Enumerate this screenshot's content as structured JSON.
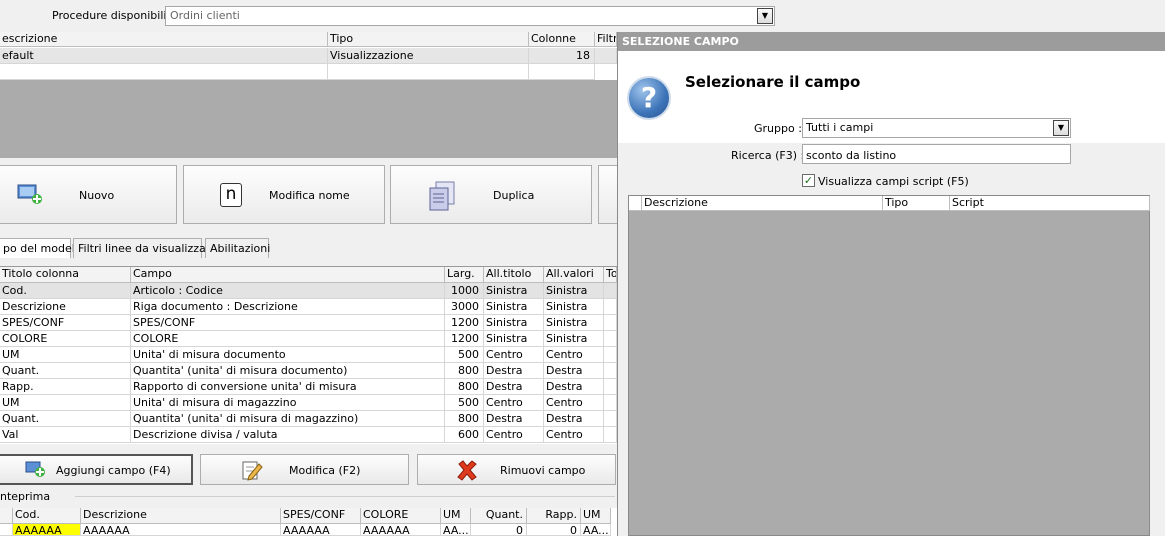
{
  "procedure": {
    "label": "Procedure disponibili :",
    "value": "Ordini clienti"
  },
  "model_grid": {
    "headers": [
      "escrizione",
      "Tipo",
      "Colonne",
      "Filtri"
    ],
    "rows": [
      {
        "descrizione": "efault",
        "tipo": "Visualizzazione",
        "colonne": "18"
      }
    ]
  },
  "buttons": {
    "nuovo": "Nuovo",
    "modifica_nome": "Modifica nome",
    "duplica": "Duplica",
    "n_glyph": "n"
  },
  "tabs": [
    "po del modello",
    "Filtri linee da visualizzare",
    "Abilitazioni"
  ],
  "columns_grid": {
    "headers": [
      "Titolo colonna",
      "Campo",
      "Larg.",
      "All.titolo",
      "All.valori",
      "To"
    ],
    "rows": [
      [
        "Cod.",
        "Articolo : Codice",
        "1000",
        "Sinistra",
        "Sinistra"
      ],
      [
        "Descrizione",
        "Riga documento : Descrizione",
        "3000",
        "Sinistra",
        "Sinistra"
      ],
      [
        "SPES/CONF",
        "SPES/CONF",
        "1200",
        "Sinistra",
        "Sinistra"
      ],
      [
        "COLORE",
        "COLORE",
        "1200",
        "Sinistra",
        "Sinistra"
      ],
      [
        "UM",
        "Unita' di misura documento",
        "500",
        "Centro",
        "Centro"
      ],
      [
        "Quant.",
        "Quantita' (unita' di misura documento)",
        "800",
        "Destra",
        "Destra"
      ],
      [
        "Rapp.",
        "Rapporto di conversione unita' di misura",
        "800",
        "Destra",
        "Destra"
      ],
      [
        "UM",
        "Unita' di misura di magazzino",
        "500",
        "Centro",
        "Centro"
      ],
      [
        "Quant.",
        "Quantita' (unita' di misura di magazzino)",
        "800",
        "Destra",
        "Destra"
      ],
      [
        "Val",
        "Descrizione divisa / valuta",
        "600",
        "Centro",
        "Centro"
      ]
    ]
  },
  "actions": {
    "aggiungi": "Aggiungi campo (F4)",
    "modifica": "Modifica (F2)",
    "rimuovi": "Rimuovi campo"
  },
  "preview": {
    "label": "nteprima",
    "headers": [
      "Cod.",
      "Descrizione",
      "SPES/CONF",
      "COLORE",
      "UM",
      "Quant.",
      "Rapp.",
      "UM"
    ],
    "row": [
      "AAAAAA",
      "AAAAAA",
      "AAAAAA",
      "AAAAAA",
      "AA...",
      "0",
      "0",
      "AA..."
    ]
  },
  "dialog": {
    "title": "SELEZIONE CAMPO",
    "heading": "Selezionare il campo",
    "icon_glyph": "?",
    "gruppo_label": "Gruppo :",
    "gruppo_value": "Tutti i campi",
    "ricerca_label": "Ricerca (F3) :",
    "ricerca_value": "sconto da listino",
    "checkbox_label": "Visualizza campi script (F5)",
    "checkbox_checked": true,
    "grid_headers": [
      "Descrizione",
      "Tipo",
      "Script"
    ]
  },
  "colors": {
    "highlight_cell": "#ffff00",
    "dialog_title_bg": "#9c9c9c",
    "empty_area": "#ababab"
  }
}
